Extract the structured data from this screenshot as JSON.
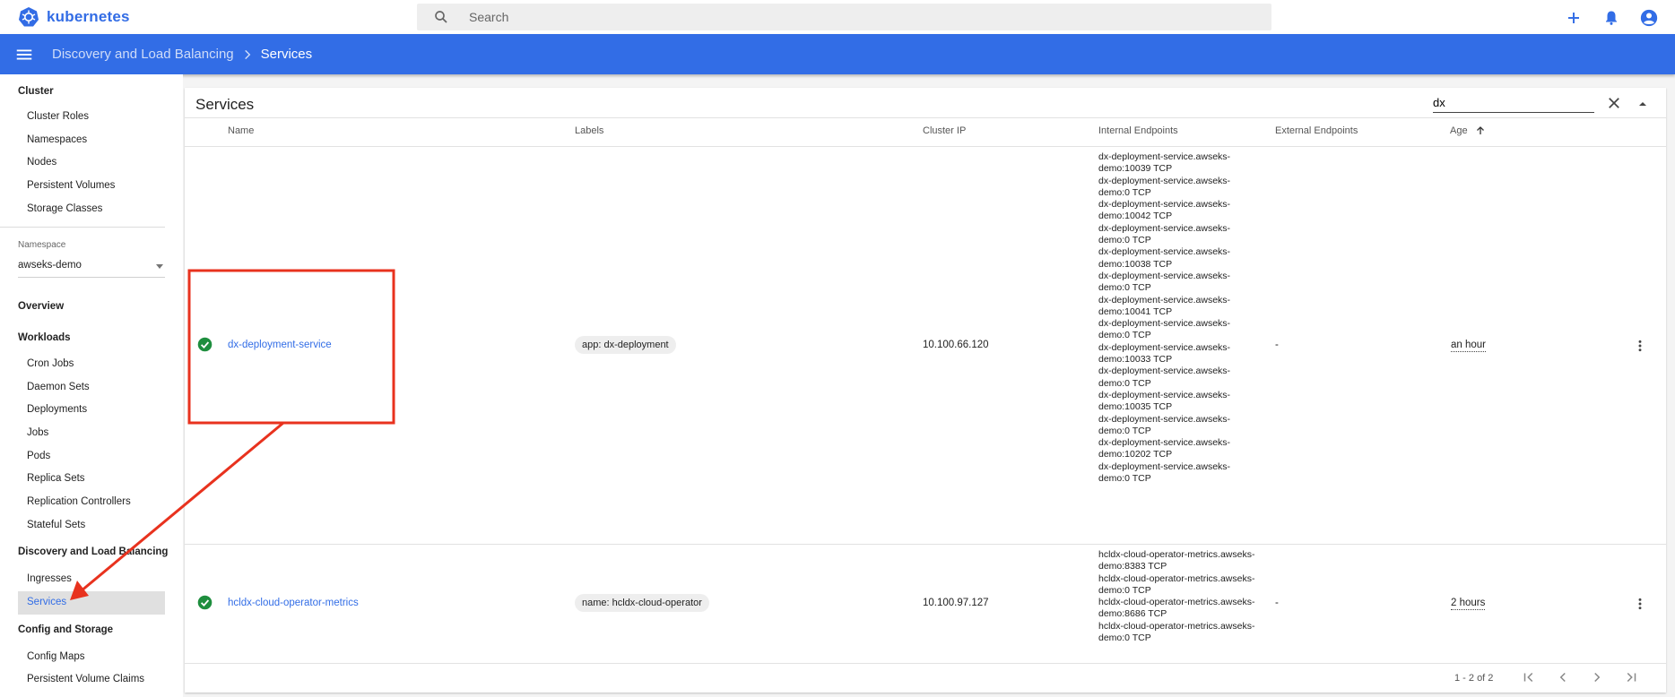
{
  "app": {
    "brand_name": "kubernetes",
    "brand_color": "#326ce5"
  },
  "search": {
    "placeholder": "Search"
  },
  "breadcrumb": {
    "parent": "Discovery and Load Balancing",
    "current": "Services"
  },
  "sidebar": {
    "cluster_title": "Cluster",
    "cluster_items": [
      "Cluster Roles",
      "Namespaces",
      "Nodes",
      "Persistent Volumes",
      "Storage Classes"
    ],
    "namespace_label": "Namespace",
    "namespace_value": "awseks-demo",
    "overview": "Overview",
    "workloads_title": "Workloads",
    "workloads_items": [
      "Cron Jobs",
      "Daemon Sets",
      "Deployments",
      "Jobs",
      "Pods",
      "Replica Sets",
      "Replication Controllers",
      "Stateful Sets"
    ],
    "discovery_title": "Discovery and Load Balancing",
    "discovery_items": [
      "Ingresses",
      "Services"
    ],
    "config_title": "Config and Storage",
    "config_items": [
      "Config Maps",
      "Persistent Volume Claims"
    ]
  },
  "card": {
    "title": "Services",
    "filter_value": "dx"
  },
  "table": {
    "headers": {
      "name": "Name",
      "labels": "Labels",
      "cluster_ip": "Cluster IP",
      "internal_endpoints": "Internal Endpoints",
      "external_endpoints": "External Endpoints",
      "age": "Age"
    },
    "rows": [
      {
        "status": "ok",
        "name": "dx-deployment-service",
        "label": "app: dx-deployment",
        "cluster_ip": "10.100.66.120",
        "internal_endpoints": [
          "dx-deployment-service.awseks-",
          "demo:10039 TCP",
          "dx-deployment-service.awseks-",
          "demo:0 TCP",
          "dx-deployment-service.awseks-",
          "demo:10042 TCP",
          "dx-deployment-service.awseks-",
          "demo:0 TCP",
          "dx-deployment-service.awseks-",
          "demo:10038 TCP",
          "dx-deployment-service.awseks-",
          "demo:0 TCP",
          "dx-deployment-service.awseks-",
          "demo:10041 TCP",
          "dx-deployment-service.awseks-",
          "demo:0 TCP",
          "dx-deployment-service.awseks-",
          "demo:10033 TCP",
          "dx-deployment-service.awseks-",
          "demo:0 TCP",
          "dx-deployment-service.awseks-",
          "demo:10035 TCP",
          "dx-deployment-service.awseks-",
          "demo:0 TCP",
          "dx-deployment-service.awseks-",
          "demo:10202 TCP",
          "dx-deployment-service.awseks-",
          "demo:0 TCP"
        ],
        "external_endpoints": "-",
        "age": "an hour"
      },
      {
        "status": "ok",
        "name": "hcldx-cloud-operator-metrics",
        "label": "name: hcldx-cloud-operator",
        "cluster_ip": "10.100.97.127",
        "internal_endpoints": [
          "hcldx-cloud-operator-metrics.awseks-",
          "demo:8383 TCP",
          "hcldx-cloud-operator-metrics.awseks-",
          "demo:0 TCP",
          "hcldx-cloud-operator-metrics.awseks-",
          "demo:8686 TCP",
          "hcldx-cloud-operator-metrics.awseks-",
          "demo:0 TCP"
        ],
        "external_endpoints": "-",
        "age": "2 hours"
      }
    ]
  },
  "pagination": {
    "range": "1 - 2 of 2"
  },
  "colors": {
    "primary": "#326de6",
    "status_ok": "#1e8e3e",
    "annotation": "#e8321e"
  }
}
